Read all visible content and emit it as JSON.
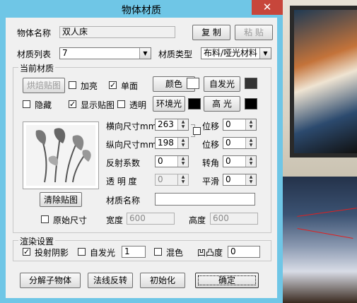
{
  "window": {
    "title": "物体材质",
    "close_glyph": "✕"
  },
  "object_name": {
    "label": "物体名称",
    "value": "双人床"
  },
  "buttons": {
    "copy": "复 制",
    "paste": "粘 贴",
    "color": "颜色",
    "glow": "自发光",
    "ambient": "环境光",
    "specular": "高 光",
    "clear_texture": "清除贴图",
    "bake_texture": "烘焙贴图",
    "decompose": "分解子物体",
    "flip_normal": "法线反转",
    "initialize": "初始化",
    "ok": "确定"
  },
  "material_list": {
    "label": "材质列表",
    "value": "7"
  },
  "material_type": {
    "label": "材质类型",
    "value": "布料/哑光材料"
  },
  "current_group": {
    "title": "当前材质"
  },
  "checks": {
    "highlight": {
      "label": "加亮",
      "checked": false
    },
    "single_face": {
      "label": "单面",
      "checked": true
    },
    "hide": {
      "label": "隐藏",
      "checked": false
    },
    "show_texture": {
      "label": "显示贴图",
      "checked": true
    },
    "transparent": {
      "label": "透明",
      "checked": false
    },
    "original_size": {
      "label": "原始尺寸",
      "checked": false
    },
    "lock_size": {
      "checked": false
    }
  },
  "swatches": {
    "color": "#ffffff",
    "glow": "#333333",
    "ambient": "#000000",
    "specular": "#000000"
  },
  "texture": {
    "h_size": {
      "label": "横向尺寸mm",
      "value": "263"
    },
    "v_size": {
      "label": "纵向尺寸mm",
      "value": "198"
    },
    "reflect": {
      "label": "反射系数",
      "value": "0"
    },
    "transparency": {
      "label": "透 明 度",
      "value": "0"
    },
    "offset1": {
      "label": "位移",
      "value": "0"
    },
    "offset2": {
      "label": "位移",
      "value": "0"
    },
    "rotate": {
      "label": "转角",
      "value": "0"
    },
    "smooth": {
      "label": "平滑",
      "value": "0"
    },
    "material_name": {
      "label": "材质名称",
      "value": ""
    },
    "width": {
      "label": "宽度",
      "value": "600"
    },
    "height": {
      "label": "高度",
      "value": "600"
    }
  },
  "render_group": {
    "title": "渲染设置",
    "cast_shadow": {
      "label": "投射阴影",
      "checked": true
    },
    "self_glow": {
      "label": "自发光",
      "checked": false,
      "value": "1"
    },
    "blend": {
      "label": "混色",
      "checked": false
    },
    "bump": {
      "label": "凹凸度",
      "value": "0"
    }
  }
}
